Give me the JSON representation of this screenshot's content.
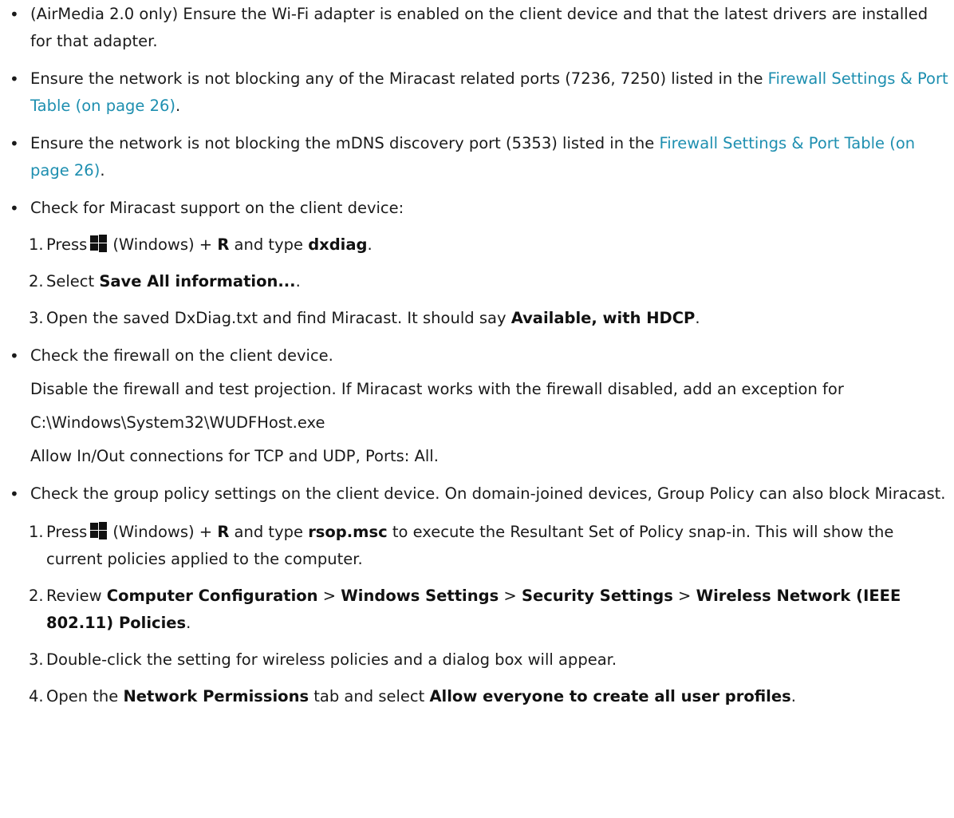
{
  "bullets": [
    {
      "text": "(AirMedia 2.0 only) Ensure the Wi-Fi adapter is enabled on the client device and that the latest drivers are installed for that adapter."
    },
    {
      "pre": "Ensure the network is not blocking any of the Miracast related ports (7236, 7250) listed in the ",
      "link": "Firewall Settings & Port Table (on page 26)",
      "post": "."
    },
    {
      "pre": "Ensure the network is not blocking the mDNS discovery port (5353) listed in the ",
      "link": "Firewall Settings & Port Table (on page 26)",
      "post": "."
    },
    {
      "text": "Check for Miracast support on the client device:",
      "steps": [
        {
          "num": "1.",
          "pre": "Press",
          "mid": "(Windows) + ",
          "key": "R",
          "mid2": " and type ",
          "cmd": "dxdiag",
          "post": "."
        },
        {
          "num": "2.",
          "pre": "Select ",
          "strong": "Save All information...",
          "post": "."
        },
        {
          "num": "3.",
          "pre": "Open the saved DxDiag.txt and find Miracast. It should say ",
          "strong": "Available, with HDCP",
          "post": "."
        }
      ]
    },
    {
      "text": "Check the firewall on the client device.",
      "paras": [
        "Disable the firewall and test projection. If Miracast works with the firewall disabled, add an exception for",
        "C:\\Windows\\System32\\WUDFHost.exe",
        "Allow In/Out connections for TCP and UDP, Ports: All."
      ]
    },
    {
      "text": "Check the group policy settings on the client device. On domain-joined devices, Group Policy can also block Miracast.",
      "steps": [
        {
          "num": "1.",
          "pre": "Press",
          "mid": "(Windows) + ",
          "key": "R",
          "mid2": " and type ",
          "cmd": "rsop.msc",
          "post": " to execute the Resultant Set of Policy snap-in. This will show the current policies applied to the computer."
        },
        {
          "num": "2.",
          "pre": "Review ",
          "p1": "Computer Configuration",
          "sep1": " > ",
          "p2": "Windows Settings",
          "sep2": " > ",
          "p3": "Security Settings",
          "sep3": " > ",
          "p4": "Wireless Network (IEEE 802.11) Policies",
          "post": "."
        },
        {
          "num": "3.",
          "pre": "Double-click the setting for wireless policies and a dialog box will appear."
        },
        {
          "num": "4.",
          "pre": "Open the ",
          "strong": "Network Permissions",
          "mid": " tab and select ",
          "strong2": "Allow everyone to create all user profiles",
          "post": "."
        }
      ]
    }
  ],
  "bullet_glyph": "•",
  "colors": {
    "link": "#1e8fb0",
    "text": "#1a1a1a"
  },
  "icons": {
    "windows": "windows-logo-icon"
  }
}
